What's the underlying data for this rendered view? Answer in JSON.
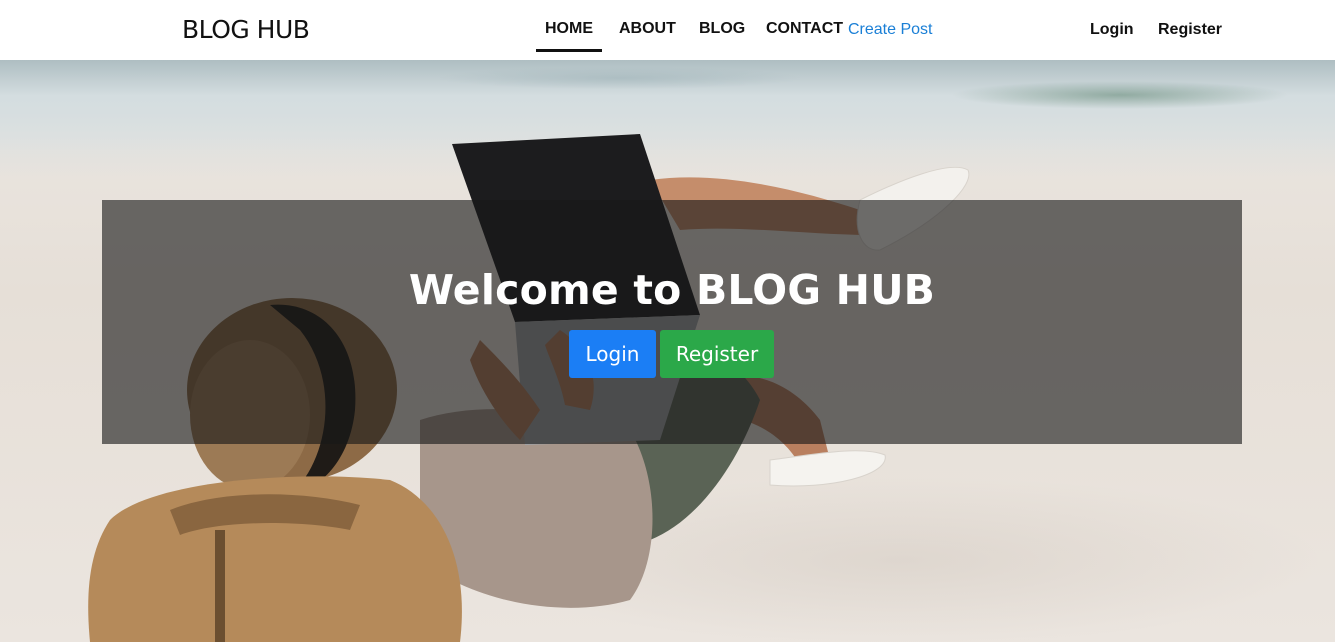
{
  "brand": "BLOG HUB",
  "nav": {
    "home": "HOME",
    "about": "ABOUT",
    "blog": "BLOG",
    "contact": "CONTACT",
    "create_post": "Create Post"
  },
  "auth": {
    "login": "Login",
    "register": "Register"
  },
  "hero": {
    "title": "Welcome to BLOG HUB",
    "login_button": "Login",
    "register_button": "Register",
    "image_subject": "person-lying-on-beach-with-laptop"
  },
  "colors": {
    "primary_button": "#1b7ef5",
    "success_button": "#2ba849",
    "create_post_link": "#1a7fd6",
    "overlay": "rgba(25,25,25,0.62)"
  }
}
